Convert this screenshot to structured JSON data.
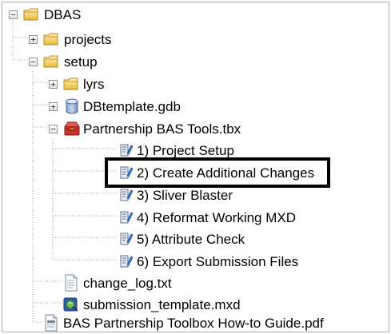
{
  "tree": {
    "root": {
      "label": "DBAS",
      "expander": "−"
    },
    "projects": {
      "label": "projects",
      "expander": "+"
    },
    "setup": {
      "label": "setup",
      "expander": "−"
    },
    "lyrs": {
      "label": "lyrs",
      "expander": "+"
    },
    "dbtemplate": {
      "label": "DBtemplate.gdb",
      "expander": "+"
    },
    "toolbox": {
      "label": "Partnership BAS Tools.tbx",
      "expander": "−"
    },
    "tools": [
      {
        "label": "1) Project Setup"
      },
      {
        "label": "2) Create Additional Changes"
      },
      {
        "label": "3) Sliver Blaster"
      },
      {
        "label": "4) Reformat Working MXD"
      },
      {
        "label": "5) Attribute Check"
      },
      {
        "label": "6) Export Submission Files"
      }
    ],
    "change_log": {
      "label": "change_log.txt"
    },
    "submission_template": {
      "label": "submission_template.mxd"
    },
    "guide_pdf": {
      "label": "BAS Partnership Toolbox How-to Guide.pdf"
    }
  },
  "icons": {
    "folder": "folder-icon",
    "geodatabase": "geodatabase-icon",
    "toolbox": "toolbox-icon",
    "script_tool": "script-tool-icon",
    "text_file": "text-file-icon",
    "map_document": "map-document-icon",
    "pdf_file": "pdf-file-icon"
  },
  "colors": {
    "folder_yellow": "#f2cf5b",
    "highlight_border": "#000000"
  }
}
